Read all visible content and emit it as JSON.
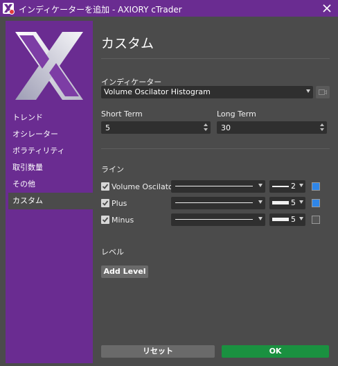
{
  "window": {
    "title": "インディケーターを追加 - AXIORY cTrader",
    "close_glyph": "✕"
  },
  "sidebar": {
    "items": [
      {
        "label": "トレンド"
      },
      {
        "label": "オシレーター"
      },
      {
        "label": "ボラティリティ"
      },
      {
        "label": "取引数量"
      },
      {
        "label": "その他"
      },
      {
        "label": "カスタム"
      }
    ],
    "active_index": 5
  },
  "main": {
    "title": "カスタム",
    "indicator_label": "インディケーター",
    "indicator_value": "Volume Oscilator Histogram",
    "short_term": {
      "label": "Short Term",
      "value": "5"
    },
    "long_term": {
      "label": "Long Term",
      "value": "30"
    },
    "lines_label": "ライン",
    "lines": [
      {
        "checked": true,
        "name": "Volume Oscilator",
        "width": "2",
        "color": "#2f86e8"
      },
      {
        "checked": true,
        "name": "Plus",
        "width": "5",
        "color": "#2f86e8"
      },
      {
        "checked": true,
        "name": "Minus",
        "width": "5",
        "color": "#555555"
      }
    ],
    "levels_label": "レベル",
    "add_level_label": "Add Level"
  },
  "footer": {
    "reset_label": "リセット",
    "ok_label": "OK"
  },
  "colors": {
    "accent_purple": "#6a2c91",
    "ok_green": "#1a9140",
    "background": "#4b4b4b"
  }
}
